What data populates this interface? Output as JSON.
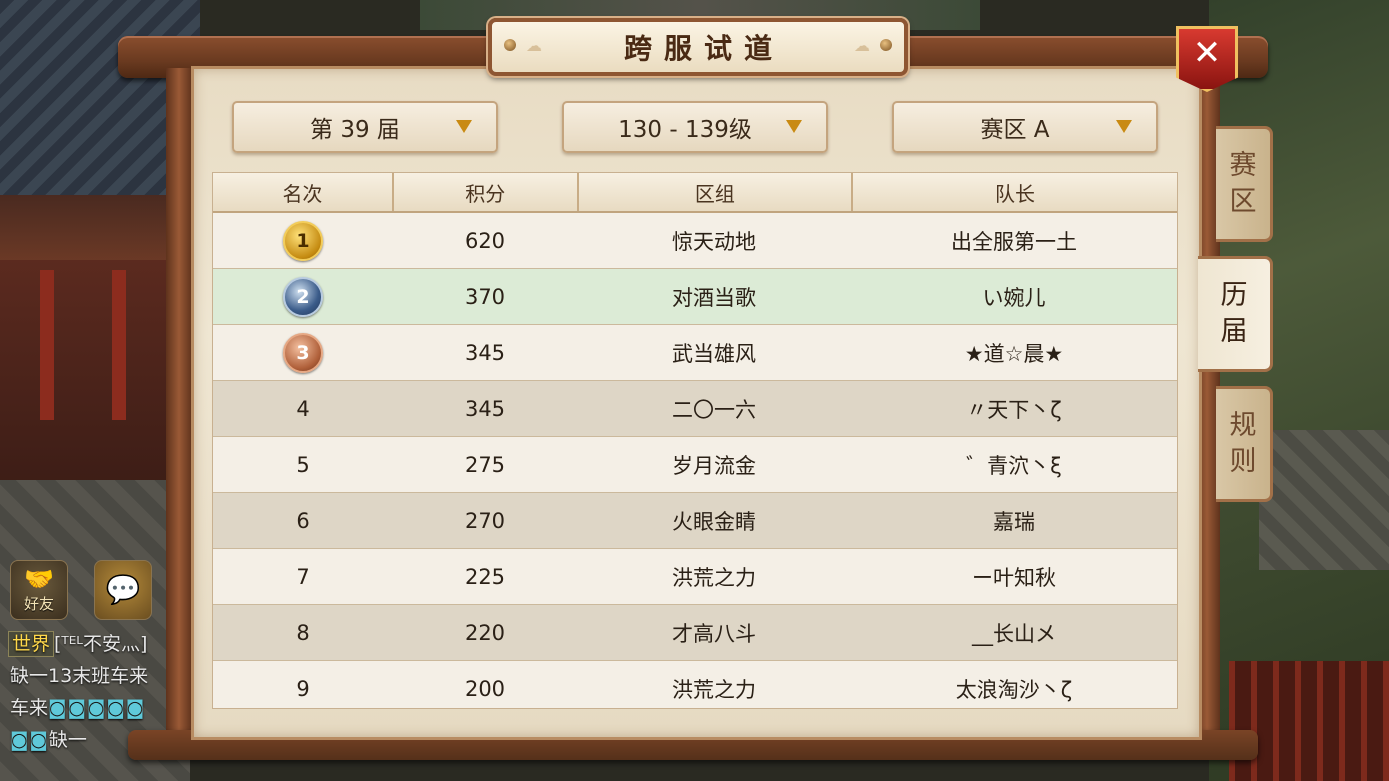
{
  "window": {
    "title": "跨服试道",
    "close_icon": "✕"
  },
  "filters": {
    "session": "第 39 届",
    "level": "130 - 139级",
    "zone": "赛区 A"
  },
  "side_tabs": [
    {
      "label_1": "赛",
      "label_2": "区",
      "active": false
    },
    {
      "label_1": "历",
      "label_2": "届",
      "active": true
    },
    {
      "label_1": "规",
      "label_2": "则",
      "active": false
    }
  ],
  "table": {
    "headers": {
      "rank": "名次",
      "score": "积分",
      "group": "区组",
      "leader": "队长"
    },
    "rows": [
      {
        "rank": "1",
        "score": "620",
        "group": "惊天动地",
        "leader": "出全服第一土"
      },
      {
        "rank": "2",
        "score": "370",
        "group": "对酒当歌",
        "leader": "い婉儿"
      },
      {
        "rank": "3",
        "score": "345",
        "group": "武当雄风",
        "leader": "★道☆晨★"
      },
      {
        "rank": "4",
        "score": "345",
        "group": "二〇一六",
        "leader": "〃天下丶ζ"
      },
      {
        "rank": "5",
        "score": "275",
        "group": "岁月流金",
        "leader": "゛青泬丶ξ"
      },
      {
        "rank": "6",
        "score": "270",
        "group": "火眼金睛",
        "leader": "嘉瑞"
      },
      {
        "rank": "7",
        "score": "225",
        "group": "洪荒之力",
        "leader": "ー叶知秋"
      },
      {
        "rank": "8",
        "score": "220",
        "group": "才高八斗",
        "leader": "__长山メ"
      },
      {
        "rank": "9",
        "score": "200",
        "group": "洪荒之力",
        "leader": "太浪淘沙丶ζ"
      }
    ]
  },
  "hud": {
    "friend_label": "好友",
    "chat_icon": "chat-bubble-icon",
    "chat_lines": {
      "channel": "世界",
      "line1_name": "[ᵀᴱᴸ不安灬]",
      "line2": "缺一13末班车来",
      "line3": "车来",
      "line3_emotes": "◙◙◙◙◙",
      "line4_emotes": "◙◙",
      "line4": "缺一"
    }
  }
}
